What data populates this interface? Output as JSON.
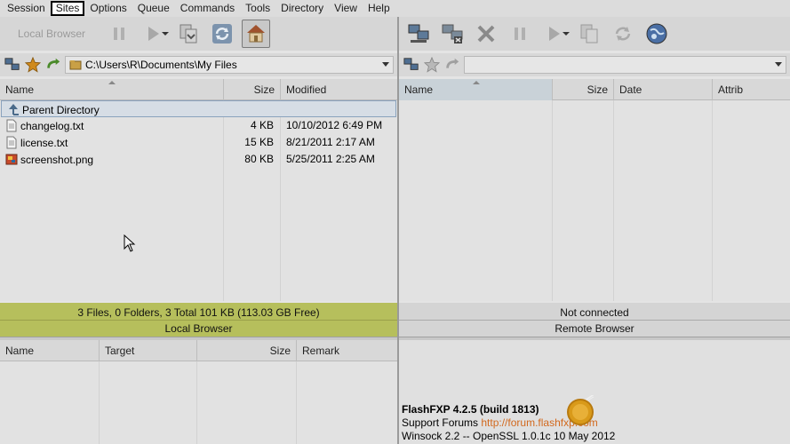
{
  "menu": {
    "items": [
      {
        "label": "Session"
      },
      {
        "label": "Sites"
      },
      {
        "label": "Options"
      },
      {
        "label": "Queue"
      },
      {
        "label": "Commands"
      },
      {
        "label": "Tools"
      },
      {
        "label": "Directory"
      },
      {
        "label": "View"
      },
      {
        "label": "Help"
      }
    ],
    "active_index": 1
  },
  "left_toolbar": {
    "local_browser_label": "Local Browser"
  },
  "left_path": {
    "value": "C:\\Users\\R\\Documents\\My Files"
  },
  "left_files": {
    "columns": {
      "name": "Name",
      "size": "Size",
      "modified": "Modified"
    },
    "rows": [
      {
        "name": "Parent Directory",
        "size": "",
        "modified": "",
        "icon": "parent-dir-icon"
      },
      {
        "name": "changelog.txt",
        "size": "4 KB",
        "modified": "10/10/2012 6:49 PM",
        "icon": "text-file-icon"
      },
      {
        "name": "license.txt",
        "size": "15 KB",
        "modified": "8/21/2011 2:17 AM",
        "icon": "text-file-icon"
      },
      {
        "name": "screenshot.png",
        "size": "80 KB",
        "modified": "5/25/2011 2:25 AM",
        "icon": "image-file-icon"
      }
    ]
  },
  "right_files": {
    "columns": {
      "name": "Name",
      "size": "Size",
      "date": "Date",
      "attrib": "Attrib"
    }
  },
  "left_status": {
    "summary": "3 Files, 0 Folders, 3 Total 101 KB (113.03 GB Free)",
    "label": "Local Browser",
    "color": "#b6bf5c"
  },
  "right_status": {
    "summary": "Not connected",
    "label": "Remote Browser"
  },
  "queue": {
    "columns": {
      "name": "Name",
      "target": "Target",
      "size": "Size",
      "remark": "Remark"
    }
  },
  "log": {
    "line1": "FlashFXP 4.2.5 (build 1813)",
    "line2_prefix": "Support Forums ",
    "line2_link": "http://forum.flashfxp.com",
    "line3": "Winsock 2.2 -- OpenSSL 1.0.1c 10 May 2012"
  }
}
